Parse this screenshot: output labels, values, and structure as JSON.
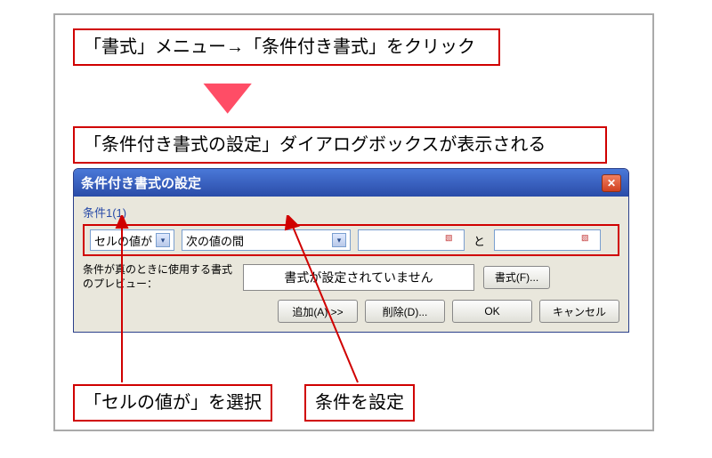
{
  "callouts": {
    "top": "「書式」メニュー→「条件付き書式」をクリック",
    "mid": "「条件付き書式の設定」ダイアログボックスが表示される",
    "bottom1": "「セルの値が」を選択",
    "bottom2": "条件を設定"
  },
  "dialog": {
    "title": "条件付き書式の設定",
    "condition_heading": "条件1(1)",
    "dropdown1": "セルの値が",
    "dropdown2": "次の値の間",
    "between_word": "と",
    "preview_label": "条件が真のときに使用する書式のプレビュー：",
    "preview_text": "書式が設定されていません",
    "format_btn": "書式(F)...",
    "add_btn": "追加(A) >>",
    "remove_btn": "削除(D)...",
    "ok_btn": "OK",
    "cancel_btn": "キャンセル"
  }
}
